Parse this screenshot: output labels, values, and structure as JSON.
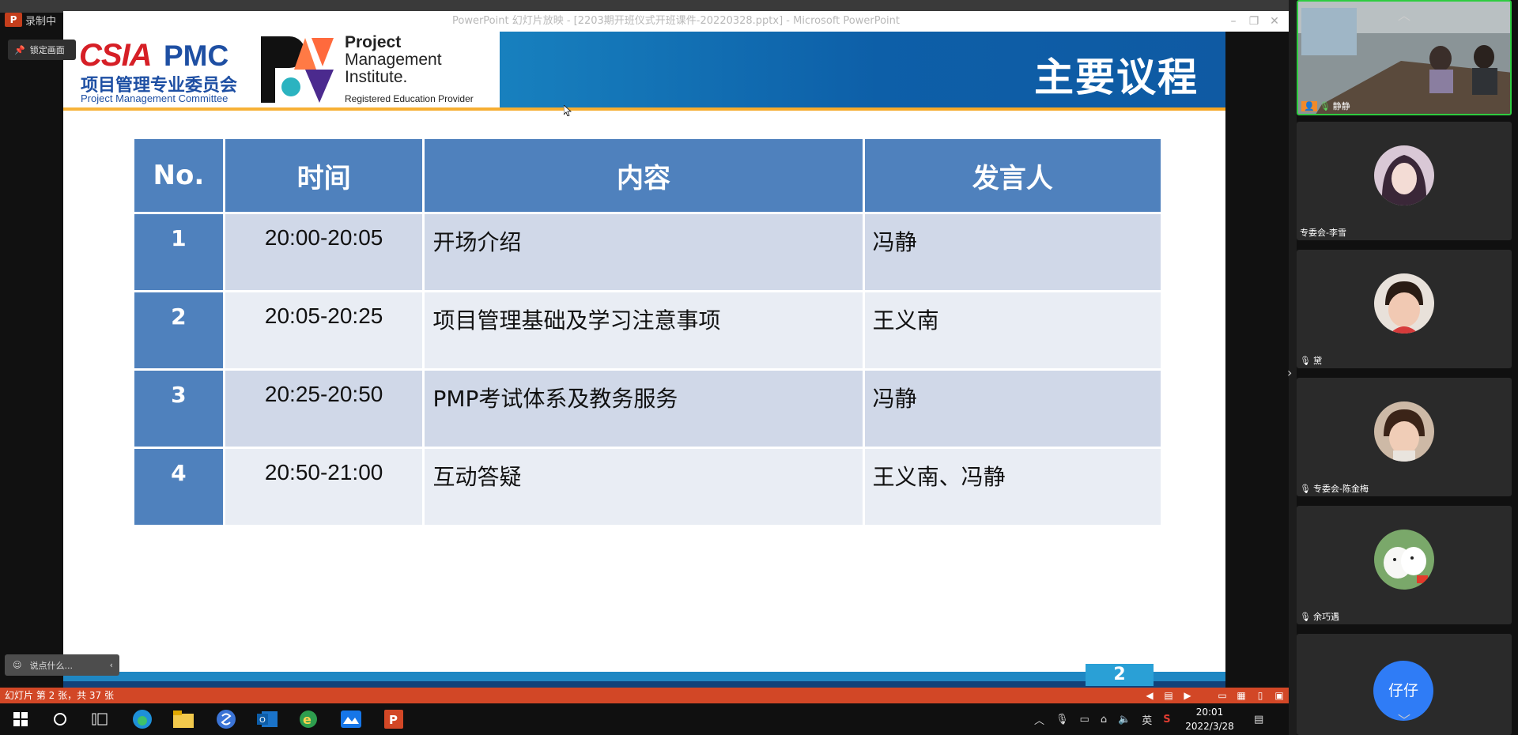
{
  "window": {
    "recording_label": "录制中",
    "title": "PowerPoint 幻灯片放映 - [2203期开班仪式开班课件-20220328.pptx] - Microsoft PowerPoint",
    "lock_label": "锁定画面"
  },
  "slide": {
    "logo_csia": "CSIA",
    "logo_pmc": "PMC",
    "logo_cn": "项目管理专业委员会",
    "logo_en": "Project Management Committee",
    "pmi_line1": "Project",
    "pmi_line2": "Management",
    "pmi_line3": "Institute.",
    "pmi_line4": "Registered Education Provider",
    "title": "主要议程",
    "headers": [
      "No.",
      "时间",
      "内容",
      "发言人"
    ],
    "rows": [
      {
        "no": "1",
        "time": "20:00-20:05",
        "content": "开场介绍",
        "speaker": "冯静"
      },
      {
        "no": "2",
        "time": "20:05-20:25",
        "content": "项目管理基础及学习注意事项",
        "speaker": "王义南"
      },
      {
        "no": "3",
        "time": "20:25-20:50",
        "content": "PMP考试体系及教务服务",
        "speaker": "冯静"
      },
      {
        "no": "4",
        "time": "20:50-21:00",
        "content": "互动答疑",
        "speaker": "王义南、冯静"
      }
    ],
    "page_number": "2"
  },
  "chat_placeholder": "说点什么...",
  "statusbar": {
    "text": "幻灯片 第 2 张，共 37 张"
  },
  "taskbar": {
    "ime": "英",
    "time": "20:01",
    "date": "2022/3/28"
  },
  "participants": [
    {
      "name": "静静"
    },
    {
      "name": "专委会-李雪"
    },
    {
      "name": "黛"
    },
    {
      "name": "专委会-陈金梅"
    },
    {
      "name": "余巧遇"
    }
  ],
  "fab_label": "仔仔",
  "colors": {
    "table_header": "#4f81bd",
    "row_a": "#d0d8e8",
    "row_b": "#e9edf4",
    "status": "#d24726"
  }
}
